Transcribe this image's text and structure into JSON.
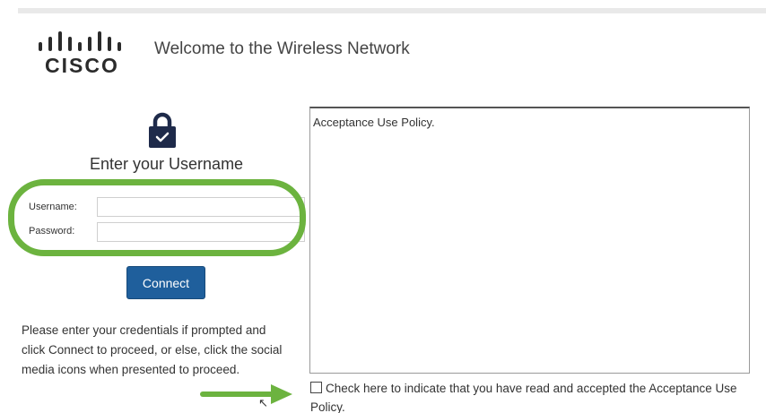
{
  "brand": {
    "logo_word": "CISCO",
    "accent_color": "#1f5f9c",
    "highlight_color": "#6cb33f"
  },
  "header": {
    "title": "Welcome to the Wireless Network"
  },
  "login": {
    "heading": "Enter your Username",
    "username_label": "Username:",
    "username_value": "",
    "password_label": "Password:",
    "password_value": "",
    "connect_label": "Connect",
    "instructions": "Please enter your credentials if prompted and click Connect to proceed, or else, click the social media icons when presented to proceed."
  },
  "policy": {
    "text": "Acceptance Use Policy.",
    "accept_label": "Check here to indicate that you have read and accepted the Acceptance Use Policy.",
    "accept_checked": false
  },
  "icons": {
    "lock": "lock-icon",
    "arrow": "arrow-right-icon",
    "logo": "cisco-logo-icon"
  }
}
